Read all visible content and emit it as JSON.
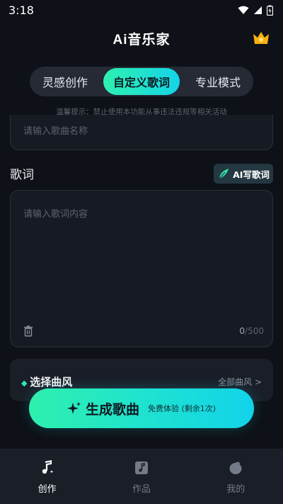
{
  "status_bar": {
    "time": "3:18"
  },
  "header": {
    "title_ai": "Ai",
    "title_rest": "音乐家",
    "crown_icon": "crown-icon"
  },
  "tabs": [
    {
      "label": "灵感创作",
      "active": false
    },
    {
      "label": "自定义歌词",
      "active": true
    },
    {
      "label": "专业模式",
      "active": false
    }
  ],
  "notice": "温馨提示：禁止使用本功能从事违法违规等相关活动",
  "song_name": {
    "placeholder": "请输入歌曲名称"
  },
  "lyrics": {
    "label": "歌词",
    "ai_write_label": "AI写歌词",
    "placeholder": "请输入歌词内容",
    "count_current": "0",
    "count_max": "/500"
  },
  "style": {
    "title": "选择曲风",
    "all_label": "全部曲风 >"
  },
  "generate": {
    "label": "生成歌曲",
    "sub_label": "免费体验 (剩余1次)"
  },
  "nav": [
    {
      "label": "创作",
      "icon": "music-note-icon",
      "active": true
    },
    {
      "label": "作品",
      "icon": "album-icon",
      "active": false
    },
    {
      "label": "我的",
      "icon": "profile-icon",
      "active": false
    }
  ],
  "colors": {
    "accent_start": "#2ff0ad",
    "accent_end": "#12d3ea",
    "background": "#0e1117"
  }
}
